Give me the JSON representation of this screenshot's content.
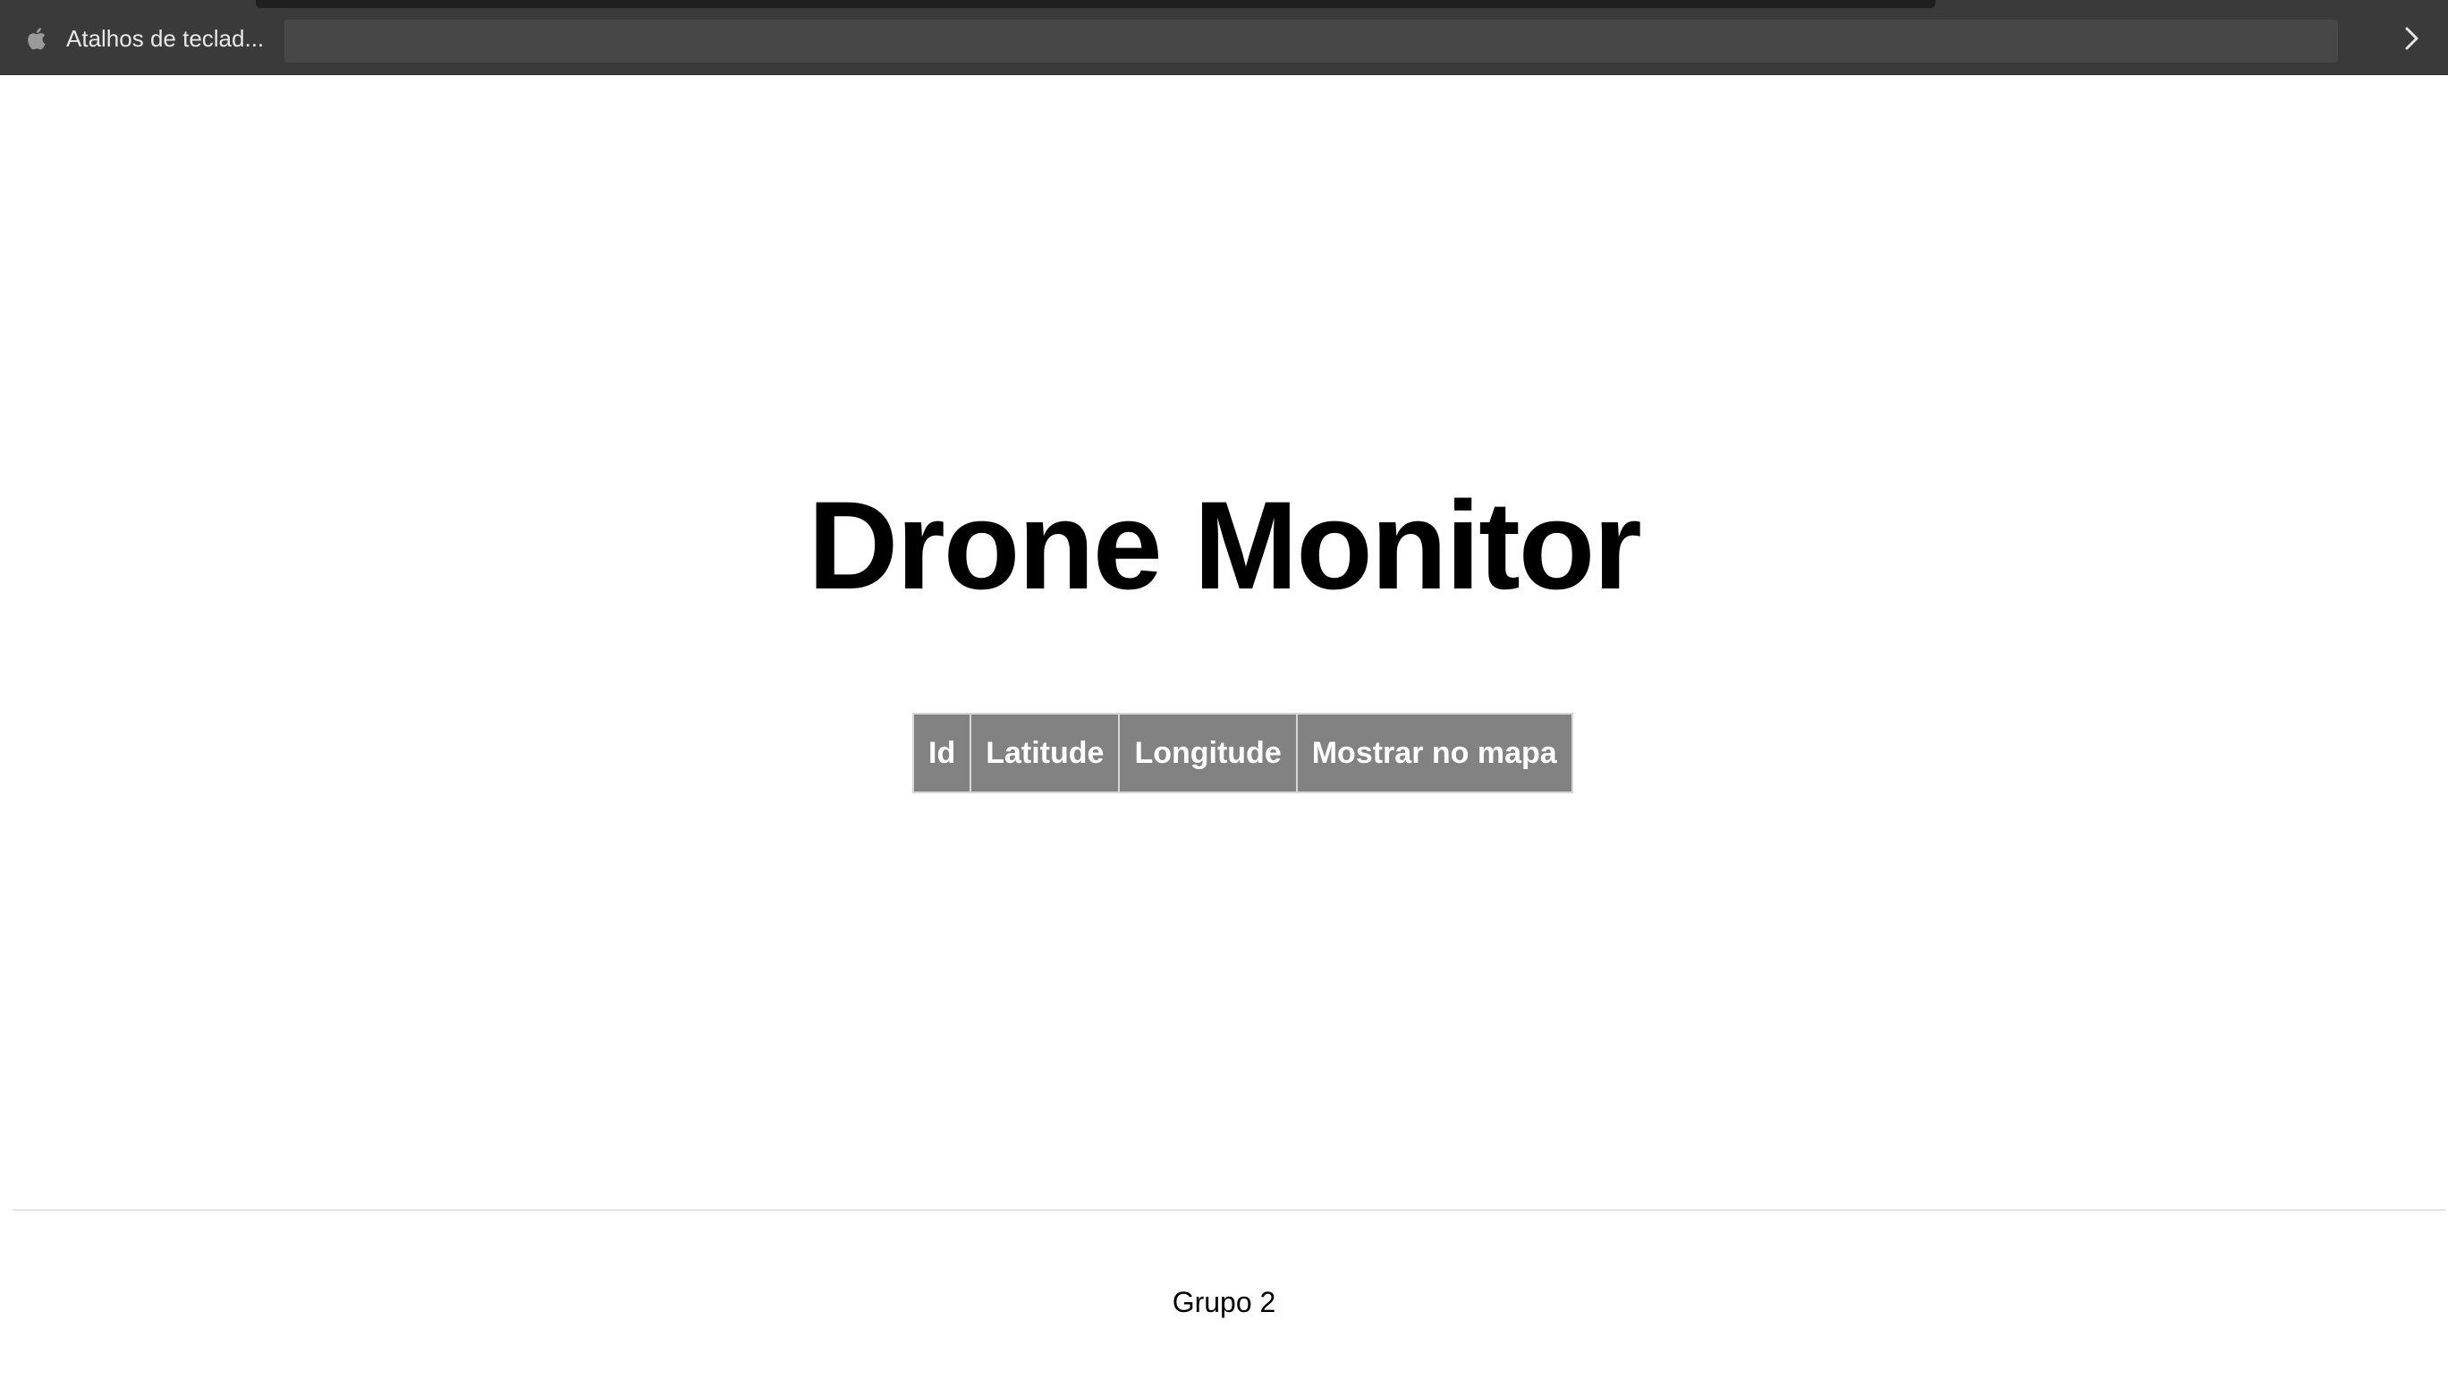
{
  "bookmarks_bar": {
    "items": [
      {
        "label": "Atalhos de teclad...",
        "icon": "apple-icon"
      }
    ],
    "overflow_icon": "chevron-right-icon"
  },
  "main": {
    "title": "Drone Monitor",
    "table": {
      "columns": [
        "Id",
        "Latitude",
        "Longitude",
        "Mostrar no mapa"
      ],
      "rows": []
    }
  },
  "footer": {
    "text": "Grupo 2"
  },
  "colors": {
    "bookmarks_bar_bg": "#3a3a3a",
    "table_header_bg": "#828282",
    "table_header_text": "#ffffff",
    "title_text": "#000000"
  }
}
